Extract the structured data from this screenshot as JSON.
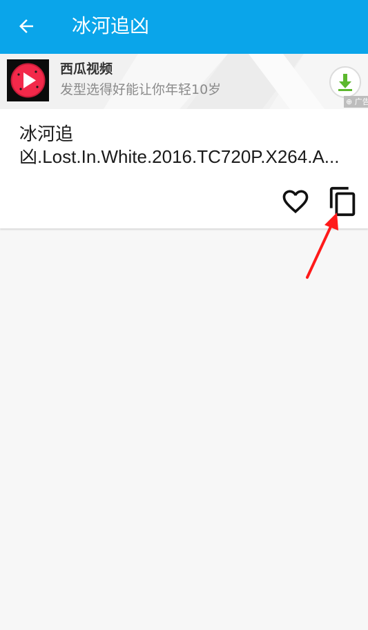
{
  "appbar": {
    "title": "冰河追凶",
    "back_icon": "arrow-left-icon",
    "background_color": "#0aa5ea"
  },
  "ad": {
    "app_name": "西瓜视频",
    "description": "发型选得好能让你年轻10岁",
    "download_icon": "download-icon",
    "tag": "广告",
    "logo_icon": "watermelon-play-logo"
  },
  "item": {
    "title_line1": "冰河追",
    "title_line2": "凶.Lost.In.White.2016.TC720P.X264.A...",
    "favorite_icon": "heart-icon",
    "copy_icon": "copy-icon"
  },
  "annotation": {
    "arrow_color": "#ff1a1a"
  }
}
